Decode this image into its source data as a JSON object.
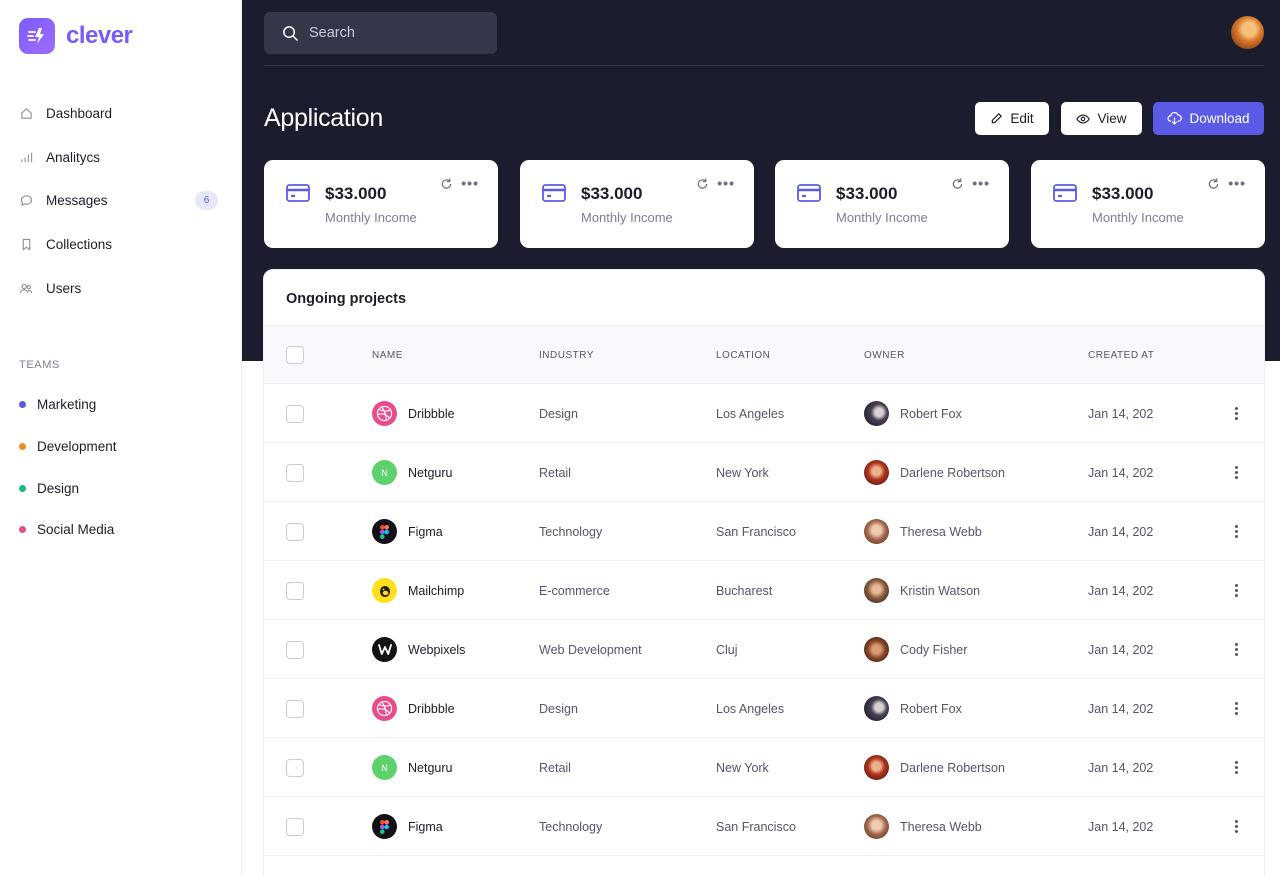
{
  "app": {
    "name": "clever",
    "accent": "#5b5be8",
    "logo_color": "#7a5af8"
  },
  "sidebar": {
    "nav": [
      {
        "label": "Dashboard",
        "icon": "home-icon"
      },
      {
        "label": "Analitycs",
        "icon": "bar-chart-icon"
      },
      {
        "label": "Messages",
        "icon": "message-icon",
        "badge": "6"
      },
      {
        "label": "Collections",
        "icon": "bookmark-icon"
      },
      {
        "label": "Users",
        "icon": "users-icon"
      }
    ],
    "teams_heading": "TEAMS",
    "teams": [
      {
        "label": "Marketing",
        "color": "#5b5be8"
      },
      {
        "label": "Development",
        "color": "#f28c1b"
      },
      {
        "label": "Design",
        "color": "#16b98a"
      },
      {
        "label": "Social Media",
        "color": "#e84b8a"
      }
    ]
  },
  "header": {
    "search_placeholder": "Search",
    "title": "Application",
    "buttons": {
      "edit": "Edit",
      "view": "View",
      "download": "Download"
    }
  },
  "stats": [
    {
      "value": "$33.000",
      "label": "Monthly Income"
    },
    {
      "value": "$33.000",
      "label": "Monthly Income"
    },
    {
      "value": "$33.000",
      "label": "Monthly Income"
    },
    {
      "value": "$33.000",
      "label": "Monthly Income"
    }
  ],
  "projects": {
    "title": "Ongoing projects",
    "columns": [
      "NAME",
      "INDUSTRY",
      "LOCATION",
      "OWNER",
      "CREATED AT"
    ],
    "rows": [
      {
        "name": "Dribbble",
        "logo": "dribbble-icon",
        "industry": "Design",
        "location": "Los Angeles",
        "owner": "Robert Fox",
        "created": "Jan 14, 202"
      },
      {
        "name": "Netguru",
        "logo": "netguru-icon",
        "industry": "Retail",
        "location": "New York",
        "owner": "Darlene Robertson",
        "created": "Jan 14, 202"
      },
      {
        "name": "Figma",
        "logo": "figma-icon",
        "industry": "Technology",
        "location": "San Francisco",
        "owner": "Theresa Webb",
        "created": "Jan 14, 202"
      },
      {
        "name": "Mailchimp",
        "logo": "mailchimp-icon",
        "industry": "E-commerce",
        "location": "Bucharest",
        "owner": "Kristin Watson",
        "created": "Jan 14, 202"
      },
      {
        "name": "Webpixels",
        "logo": "webpixels-icon",
        "industry": "Web Development",
        "location": "Cluj",
        "owner": "Cody Fisher",
        "created": "Jan 14, 202"
      },
      {
        "name": "Dribbble",
        "logo": "dribbble-icon",
        "industry": "Design",
        "location": "Los Angeles",
        "owner": "Robert Fox",
        "created": "Jan 14, 202"
      },
      {
        "name": "Netguru",
        "logo": "netguru-icon",
        "industry": "Retail",
        "location": "New York",
        "owner": "Darlene Robertson",
        "created": "Jan 14, 202"
      },
      {
        "name": "Figma",
        "logo": "figma-icon",
        "industry": "Technology",
        "location": "San Francisco",
        "owner": "Theresa Webb",
        "created": "Jan 14, 202"
      }
    ]
  }
}
